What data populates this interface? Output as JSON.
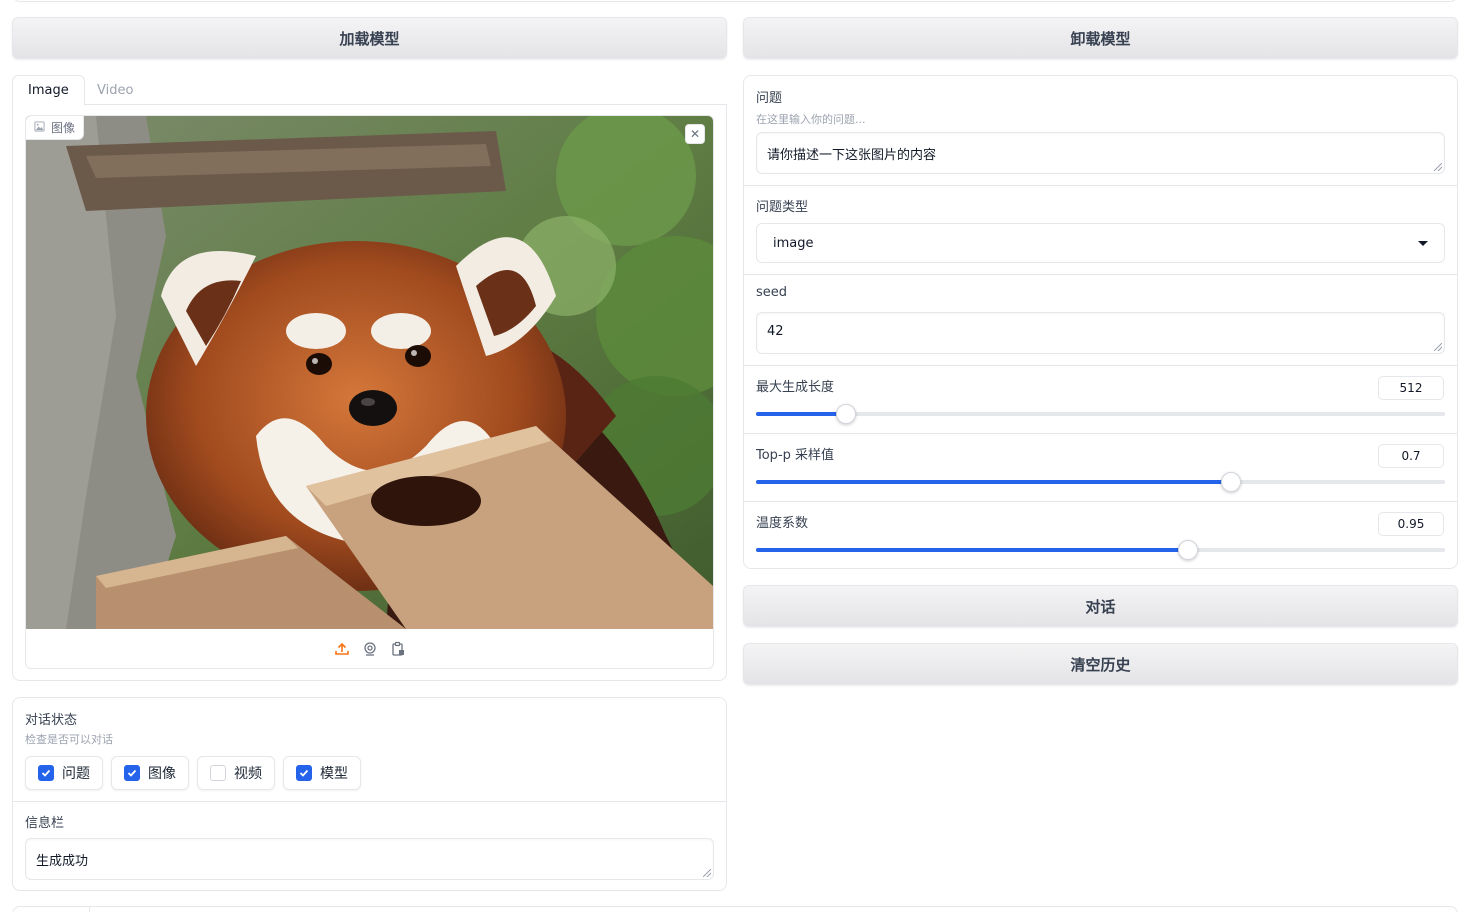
{
  "buttons": {
    "load_model": "加载模型",
    "unload_model": "卸载模型",
    "chat": "对话",
    "clear_history": "清空历史"
  },
  "input_tabs": [
    {
      "label": "Image",
      "active": true
    },
    {
      "label": "Video",
      "active": false
    }
  ],
  "image_input": {
    "label": "图像",
    "sources": [
      "upload-icon",
      "webcam-icon",
      "clipboard-icon"
    ],
    "accent_color": "#f97316"
  },
  "status": {
    "label": "对话状态",
    "info": "检查是否可以对话",
    "checks": [
      {
        "label": "问题",
        "checked": true
      },
      {
        "label": "图像",
        "checked": true
      },
      {
        "label": "视频",
        "checked": false
      },
      {
        "label": "模型",
        "checked": true
      }
    ]
  },
  "info_bar": {
    "label": "信息栏",
    "value": "生成成功"
  },
  "question": {
    "label": "问题",
    "info": "在这里输入你的问题...",
    "value": "请你描述一下这张图片的内容"
  },
  "question_type": {
    "label": "问题类型",
    "value": "image"
  },
  "seed": {
    "label": "seed",
    "value": "42"
  },
  "sliders": [
    {
      "label": "最大生成长度",
      "value": "512",
      "fraction": 0.13
    },
    {
      "label": "Top-p 采样值",
      "value": "0.7",
      "fraction": 0.69
    },
    {
      "label": "温度系数",
      "value": "0.95",
      "fraction": 0.627
    }
  ],
  "accent_color": "#2563eb"
}
